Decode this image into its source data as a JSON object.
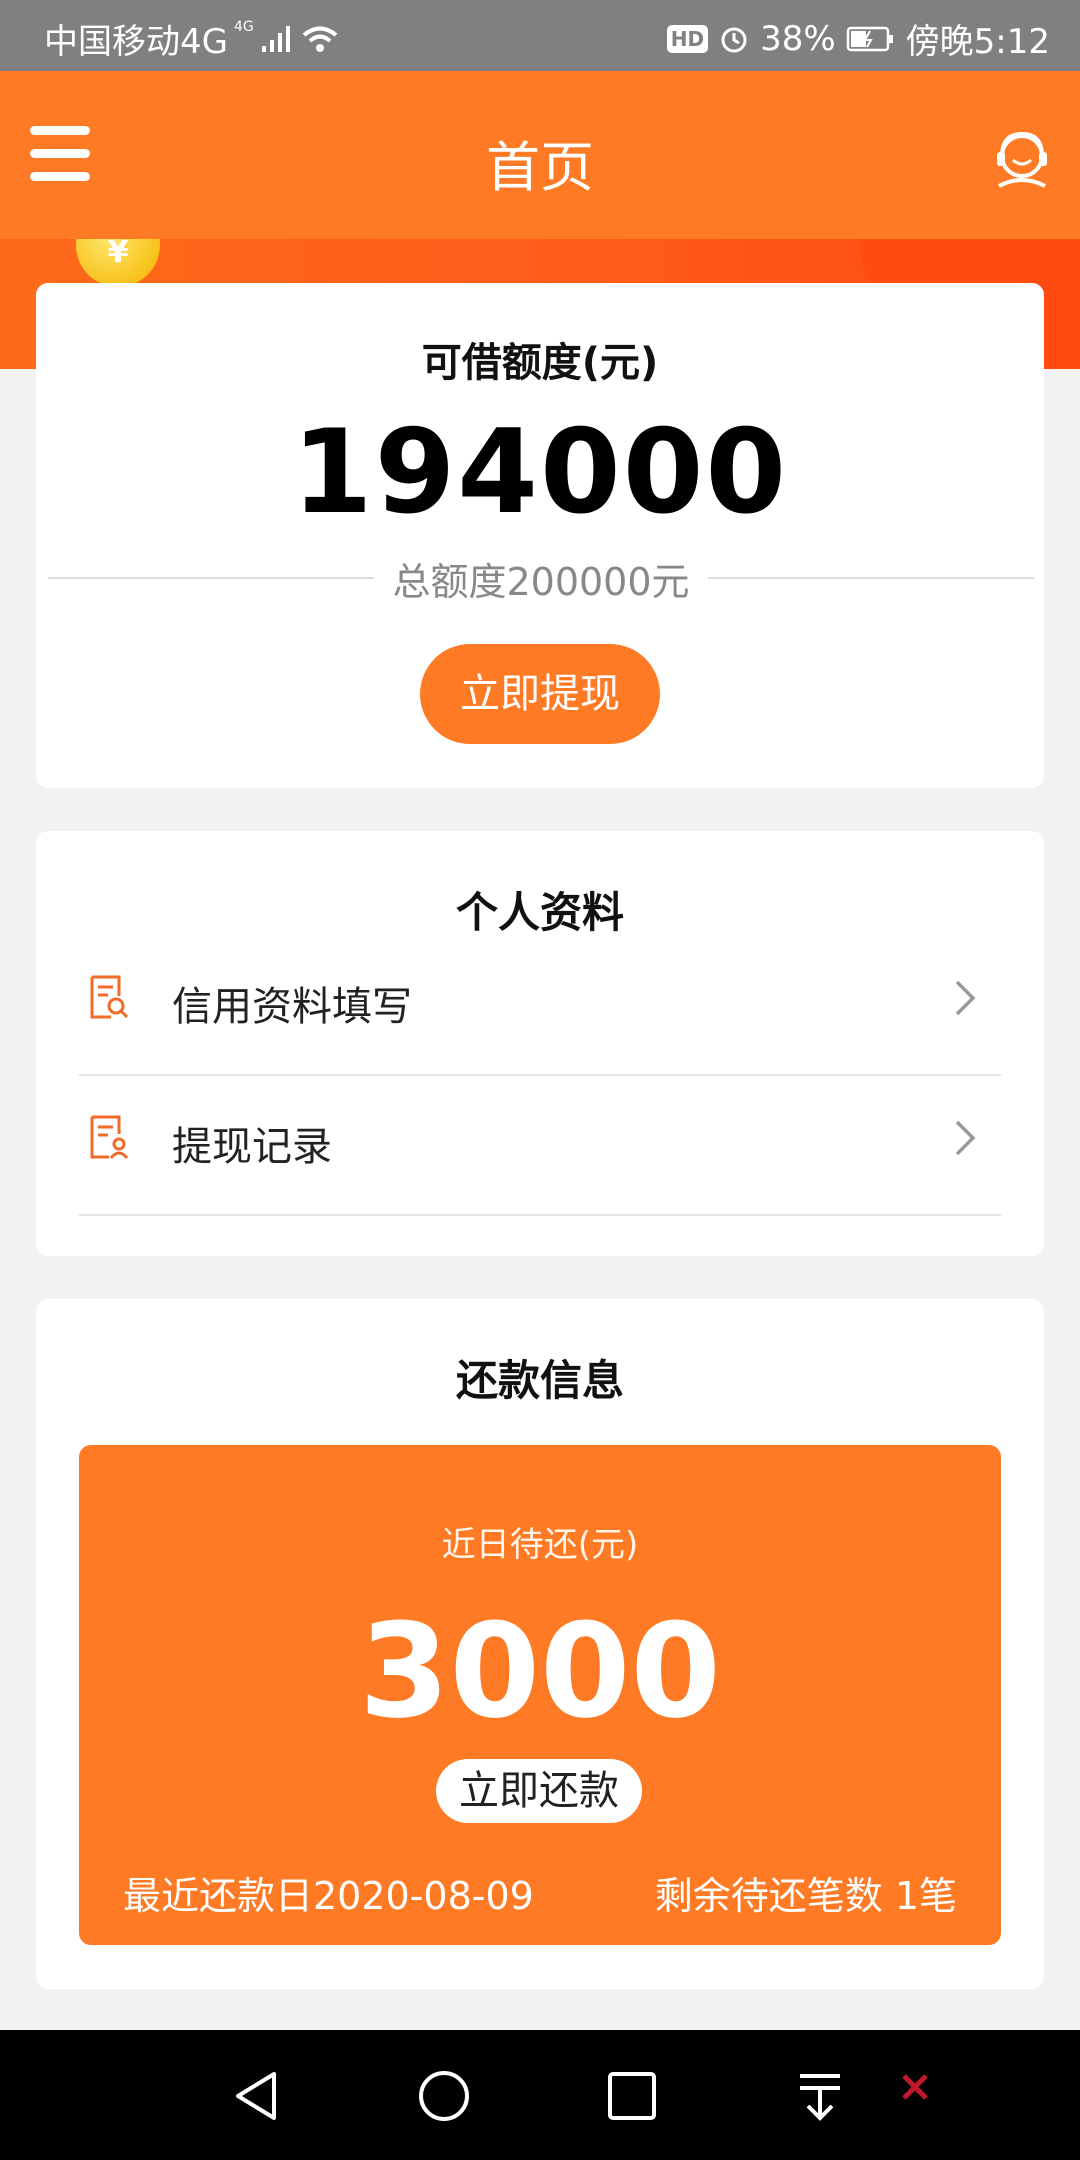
{
  "status_bar": {
    "carrier": "中国移动4G",
    "network_badge": "4G",
    "battery": "38%",
    "time": "傍晚5:12",
    "hd_badge": "HD"
  },
  "header": {
    "title": "首页",
    "menu_icon": "menu-icon",
    "support_icon": "customer-service-icon"
  },
  "credit": {
    "label": "可借额度(元)",
    "available": "194000",
    "total_text": "总额度200000元",
    "withdraw_button": "立即提现",
    "coin_symbol": "¥"
  },
  "profile": {
    "title": "个人资料",
    "items": [
      {
        "label": "信用资料填写",
        "icon": "document-search-icon"
      },
      {
        "label": "提现记录",
        "icon": "document-user-icon"
      }
    ]
  },
  "repayment": {
    "title": "还款信息",
    "due_label": "近日待还(元)",
    "due_amount": "3000",
    "repay_button": "立即还款",
    "due_date_text": "最近还款日2020-08-09",
    "remaining_text": "剩余待还笔数 1笔"
  },
  "colors": {
    "accent": "#fe7a24",
    "status_bar": "#808080"
  }
}
